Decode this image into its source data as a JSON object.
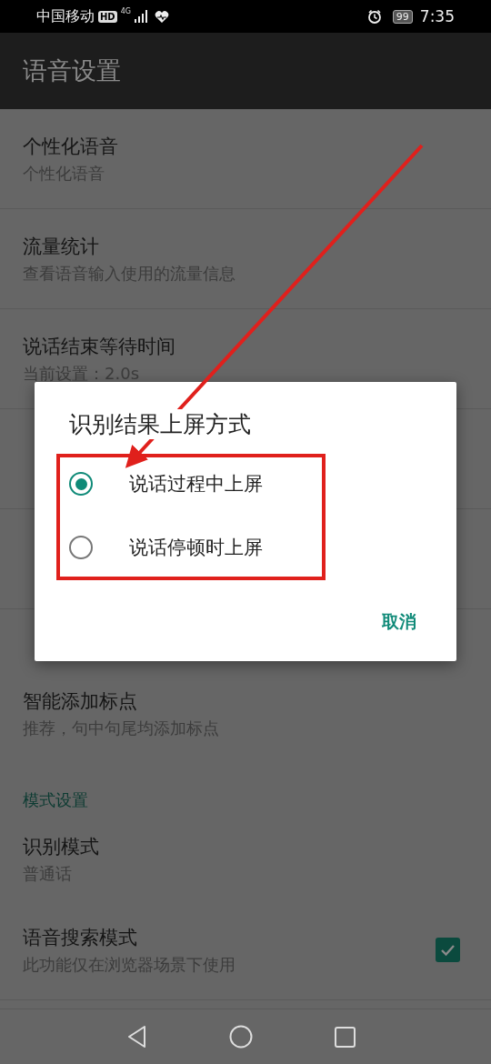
{
  "status_bar": {
    "carrier": "中国移动",
    "hd": "HD",
    "network": "4G",
    "battery": "99",
    "time": "7:35"
  },
  "app_bar": {
    "title": "语音设置"
  },
  "settings": [
    {
      "kind": "item",
      "title": "个性化语音",
      "summary": "个性化语音"
    },
    {
      "kind": "item",
      "title": "流量统计",
      "summary": "查看语音输入使用的流量信息"
    },
    {
      "kind": "item",
      "title": "说话结束等待时间",
      "summary": "当前设置：2.0s"
    },
    {
      "kind": "item"
    },
    {
      "kind": "item"
    },
    {
      "kind": "header"
    },
    {
      "kind": "item",
      "title": "智能添加标点",
      "summary": "推荐，句中句尾均添加标点"
    },
    {
      "kind": "header",
      "title": "模式设置"
    },
    {
      "kind": "item",
      "title": "识别模式",
      "summary": "普通话"
    },
    {
      "kind": "checkbox",
      "title": "语音搜索模式",
      "summary": "此功能仅在浏览器场景下使用",
      "checked": true
    }
  ],
  "dialog": {
    "title": "识别结果上屏方式",
    "options": [
      {
        "label": "说话过程中上屏",
        "selected": true
      },
      {
        "label": "说话停顿时上屏",
        "selected": false
      }
    ],
    "buttons": [
      "取消"
    ]
  }
}
